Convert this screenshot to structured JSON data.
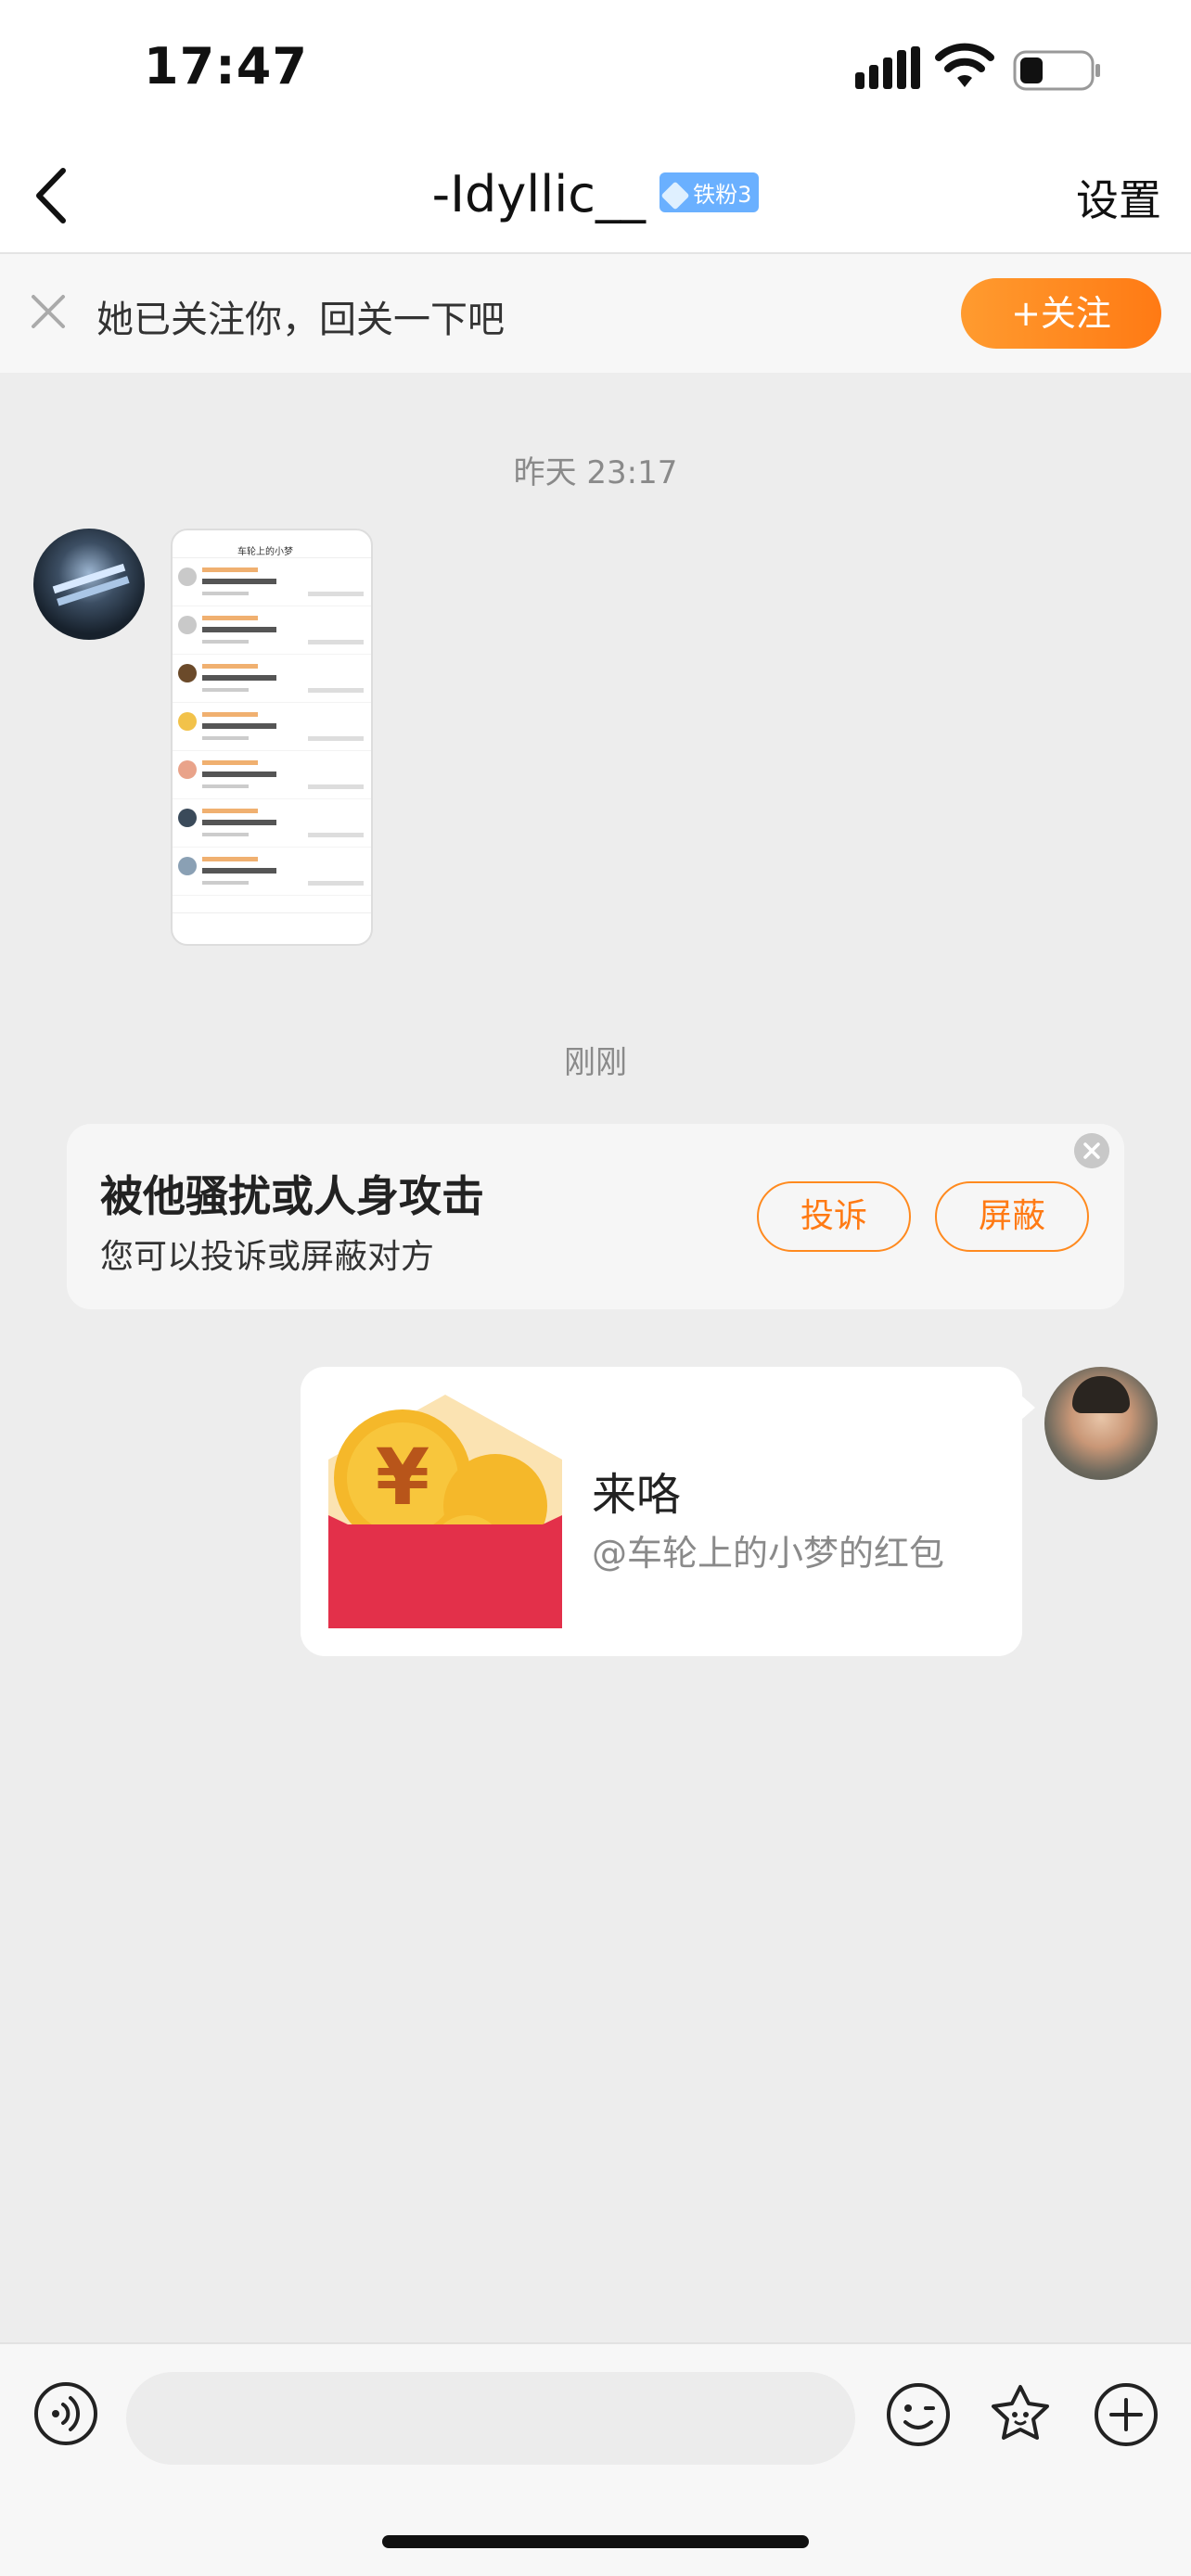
{
  "status_bar": {
    "time": "17:47"
  },
  "nav": {
    "title": "-Idyllic__",
    "badge": "铁粉3",
    "settings": "设置"
  },
  "follow_bar": {
    "text": "她已关注你，回关一下吧",
    "button": "+关注",
    "accent": "#ff8a1f"
  },
  "messages": {
    "timestamp_1": "昨天 23:17",
    "timestamp_2": "刚刚",
    "image_preview": {
      "header": "车轮上的小梦"
    }
  },
  "report_card": {
    "title": "被他骚扰或人身攻击",
    "subtitle": "您可以投诉或屏蔽对方",
    "complain_label": "投诉",
    "block_label": "屏蔽"
  },
  "red_packet": {
    "title": "来咯",
    "subtitle": "@车轮上的小梦的红包",
    "color": "#e3304a"
  },
  "input_bar": {
    "placeholder": ""
  }
}
